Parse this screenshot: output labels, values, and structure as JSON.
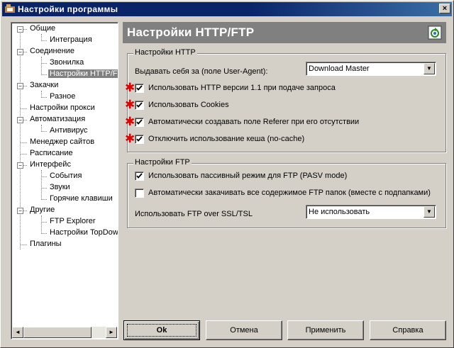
{
  "window": {
    "title": "Настройки программы",
    "close_glyph": "×"
  },
  "tree": {
    "items": [
      {
        "label": "Общие",
        "level": 0,
        "expanded": true
      },
      {
        "label": "Интеграция",
        "level": 1
      },
      {
        "label": "Соединение",
        "level": 0,
        "expanded": true
      },
      {
        "label": "Звонилка",
        "level": 1
      },
      {
        "label": "Настройки HTTP/FTP",
        "level": 1,
        "selected": true
      },
      {
        "label": "Закачки",
        "level": 0,
        "expanded": true
      },
      {
        "label": "Разное",
        "level": 1
      },
      {
        "label": "Настройки прокси",
        "level": 0
      },
      {
        "label": "Автоматизация",
        "level": 0,
        "expanded": true
      },
      {
        "label": "Антивирус",
        "level": 1
      },
      {
        "label": "Менеджер сайтов",
        "level": 0
      },
      {
        "label": "Расписание",
        "level": 0
      },
      {
        "label": "Интерфейс",
        "level": 0,
        "expanded": true
      },
      {
        "label": "События",
        "level": 1
      },
      {
        "label": "Звуки",
        "level": 1
      },
      {
        "label": "Горячие клавиши",
        "level": 1
      },
      {
        "label": "Другие",
        "level": 0,
        "expanded": true
      },
      {
        "label": "FTP Explorer",
        "level": 1
      },
      {
        "label": "Настройки TopDownloads",
        "level": 1
      },
      {
        "label": "Плагины",
        "level": 0
      }
    ],
    "scroll_left": "◄",
    "scroll_right": "►"
  },
  "header": {
    "title": "Настройки HTTP/FTP",
    "icon": "refresh-icon"
  },
  "http": {
    "legend": "Настройки HTTP",
    "user_agent_label": "Выдавать себя за (поле User-Agent):",
    "user_agent_value": "Download Master",
    "options": [
      {
        "label": "Использовать HTTP версии 1.1 при подаче запроса",
        "checked": true,
        "starred": true
      },
      {
        "label": "Использовать Cookies",
        "checked": true,
        "starred": true
      },
      {
        "label": "Автоматически создавать поле Referer при его отсутствии",
        "checked": true,
        "starred": true
      },
      {
        "label": "Отключить использование кеша (no-cache)",
        "checked": true,
        "starred": true
      }
    ]
  },
  "ftp": {
    "legend": "Настройки FTP",
    "options": [
      {
        "label": "Использовать пассивный режим для FTP (PASV mode)",
        "checked": true
      },
      {
        "label": "Автоматически закачивать все содержимое FTP папок (вместе с подпапками)",
        "checked": false
      }
    ],
    "ssl_label": "Использовать FTP over SSL/TSL",
    "ssl_value": "Не использовать"
  },
  "buttons": {
    "ok": "Ok",
    "cancel": "Отмена",
    "apply": "Применить",
    "help": "Справка"
  },
  "star_glyph": "✱",
  "combo_arrow": "▼"
}
